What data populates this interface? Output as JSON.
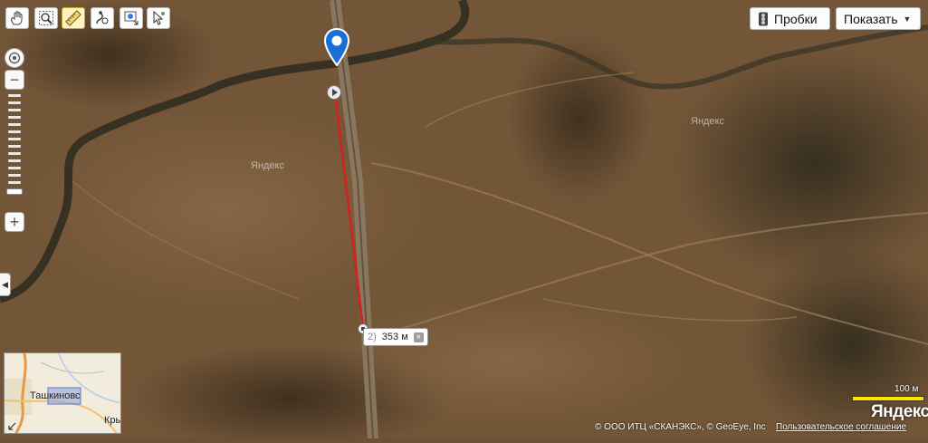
{
  "toolbar": {
    "tools": [
      {
        "name": "hand-icon",
        "label": "hand"
      },
      {
        "name": "magnifier-icon",
        "label": "zoom"
      },
      {
        "name": "ruler-icon",
        "label": "ruler",
        "active": true
      },
      {
        "name": "route-icon",
        "label": "route"
      },
      {
        "name": "add-object-icon",
        "label": "add"
      },
      {
        "name": "pointer-icon",
        "label": "pointer"
      }
    ]
  },
  "top_right": {
    "traffic_label": "Пробки",
    "show_label": "Показать",
    "show_caret": "▼"
  },
  "zoom": {
    "plus": "+",
    "minus": "−"
  },
  "panel_toggle": "◀",
  "measurement": {
    "index": "2)",
    "distance": "353 м",
    "close": "×"
  },
  "watermarks": [
    "Яндекс",
    "Яндекс"
  ],
  "minimap": {
    "town_label": "Ташкиновс",
    "town2_label": "Кры"
  },
  "scale": {
    "label": "100 м"
  },
  "logo": "Яндекс",
  "copyright": "© ООО ИТЦ «СКАНЭКС», © GeoEye, Inc",
  "agreement": "Пользовательское соглашение",
  "colors": {
    "route": "#d91e1e",
    "pin": "#1a6fd6",
    "ground": "#6b5034",
    "scale": "#ffe400"
  }
}
